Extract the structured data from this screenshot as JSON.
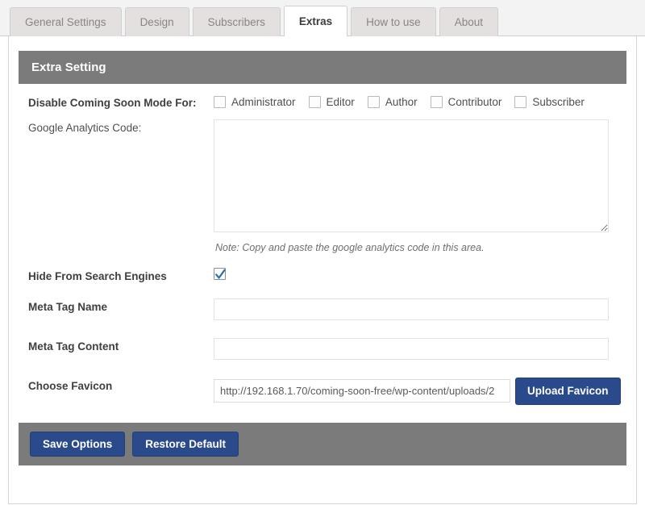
{
  "tabs": [
    {
      "label": "General Settings",
      "active": false
    },
    {
      "label": "Design",
      "active": false
    },
    {
      "label": "Subscribers",
      "active": false
    },
    {
      "label": "Extras",
      "active": true
    },
    {
      "label": "How to use",
      "active": false
    },
    {
      "label": "About",
      "active": false
    }
  ],
  "section": {
    "title": "Extra Setting"
  },
  "fields": {
    "disable_mode": {
      "label": "Disable Coming Soon Mode For:",
      "roles": [
        {
          "label": "Administrator",
          "checked": false
        },
        {
          "label": "Editor",
          "checked": false
        },
        {
          "label": "Author",
          "checked": false
        },
        {
          "label": "Contributor",
          "checked": false
        },
        {
          "label": "Subscriber",
          "checked": false
        }
      ]
    },
    "analytics": {
      "label": "Google Analytics Code:",
      "value": "",
      "note": "Note: Copy and paste the google analytics code in this area."
    },
    "hide_search": {
      "label": "Hide From Search Engines",
      "checked": true
    },
    "meta_tag_name": {
      "label": "Meta Tag Name",
      "value": ""
    },
    "meta_tag_content": {
      "label": "Meta Tag Content",
      "value": ""
    },
    "favicon": {
      "label": "Choose Favicon",
      "value": "http://192.168.1.70/coming-soon-free/wp-content/uploads/2",
      "upload_label": "Upload Favicon"
    }
  },
  "footer": {
    "save_label": "Save Options",
    "restore_label": "Restore Default"
  },
  "colors": {
    "bar_gray": "#7b7b7b",
    "button_blue": "#2b4a8b",
    "check_blue": "#2271b1",
    "tab_inactive": "#e3e0df"
  }
}
